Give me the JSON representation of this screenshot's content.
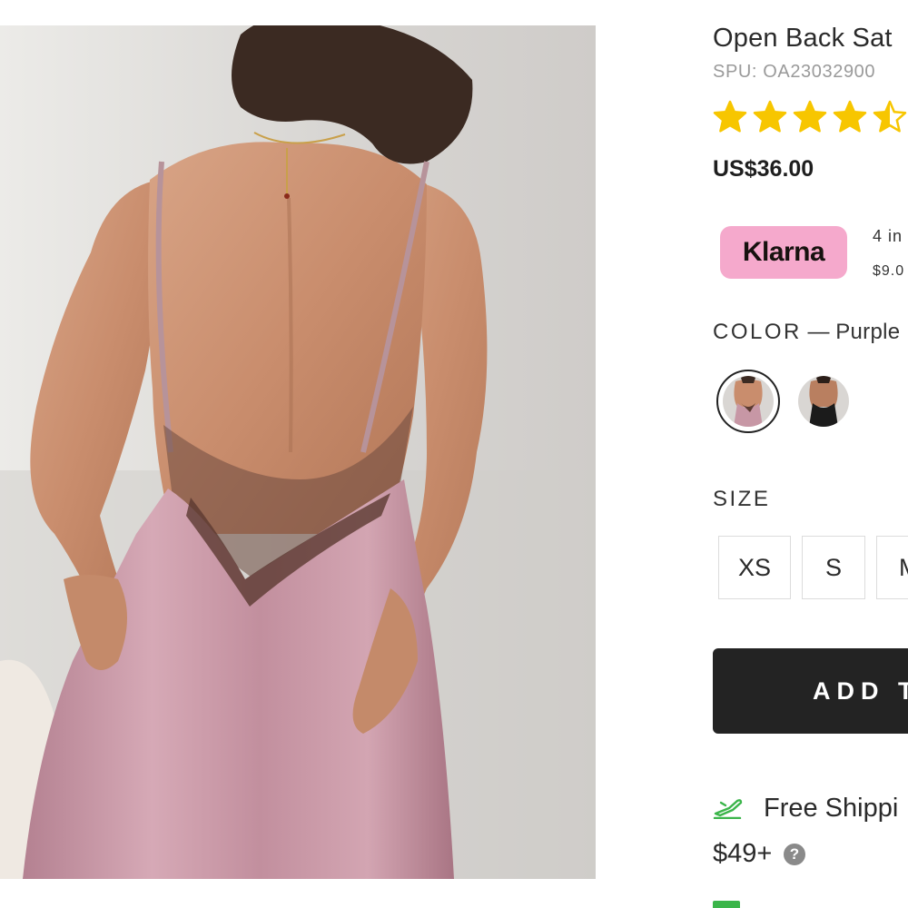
{
  "product": {
    "title": "Open Back Sat",
    "spu": "SPU: OA23032900",
    "rating": 4.5,
    "rating_max": 5,
    "price": "US$36.00",
    "star_color": "#f7c600"
  },
  "klarna": {
    "logo_text": "Klarna",
    "line1": "4 in",
    "line2": "$9.0",
    "badge_color": "#f5a9cc"
  },
  "color": {
    "label": "COLOR",
    "separator": "—",
    "selected": "Purple",
    "swatches": [
      {
        "name": "Purple",
        "selected": true
      },
      {
        "name": "Black",
        "selected": false
      }
    ]
  },
  "size": {
    "label": "SIZE",
    "options": [
      "XS",
      "S",
      "M"
    ]
  },
  "cart": {
    "add_label": "ADD T"
  },
  "shipping": {
    "text": "Free Shippi",
    "minimum": "$49+",
    "help_glyph": "?",
    "icon_color": "#3bb54a"
  }
}
